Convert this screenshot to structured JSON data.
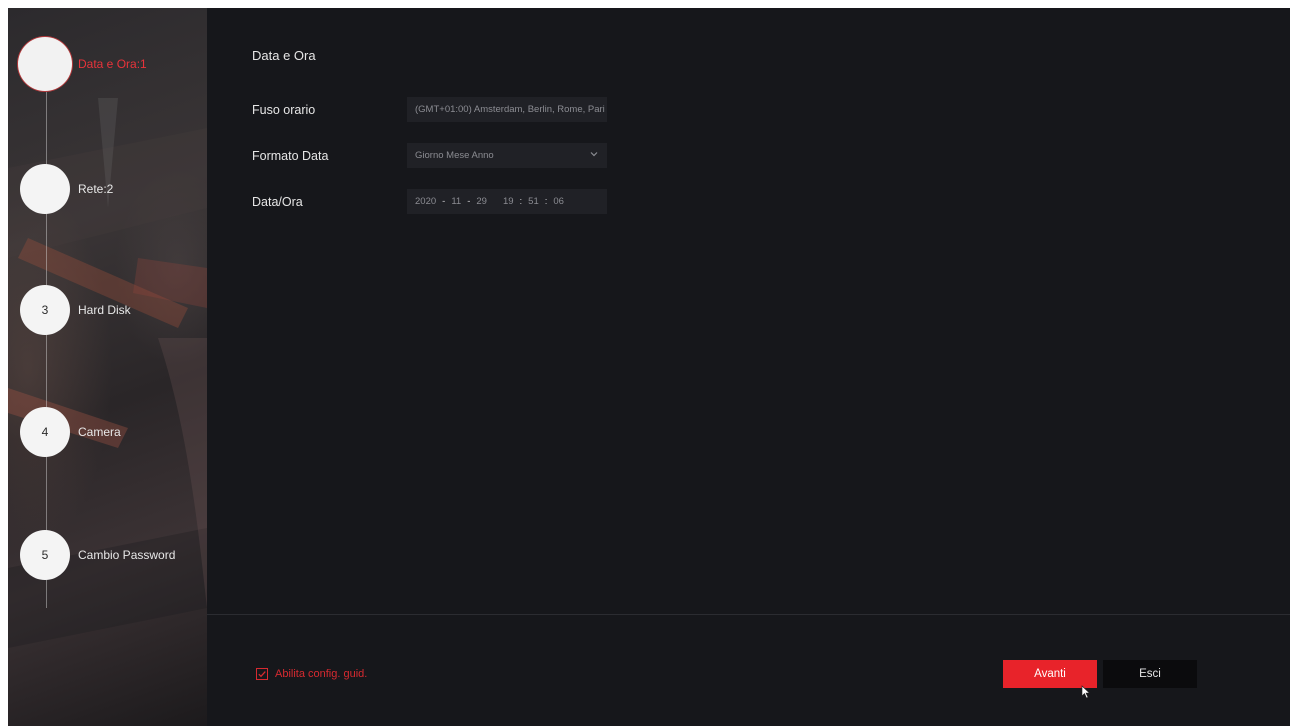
{
  "steps": [
    {
      "number": "",
      "label": "Data e Ora:1"
    },
    {
      "number": "",
      "label": "Rete:2"
    },
    {
      "number": "3",
      "label": "Hard Disk"
    },
    {
      "number": "4",
      "label": "Camera"
    },
    {
      "number": "5",
      "label": "Cambio Password"
    }
  ],
  "main": {
    "title": "Data e Ora",
    "timezone": {
      "label": "Fuso orario",
      "value": "(GMT+01:00) Amsterdam, Berlin, Rome, Pari"
    },
    "date_format": {
      "label": "Formato Data",
      "value": "Giorno Mese Anno"
    },
    "datetime": {
      "label": "Data/Ora",
      "year": "2020",
      "month": "11",
      "day": "29",
      "hour": "19",
      "minute": "51",
      "second": "06",
      "date_sep": "-",
      "time_sep": ":"
    }
  },
  "footer": {
    "checkbox_label": "Abilita config. guid.",
    "checkbox_checked": true,
    "next_label": "Avanti",
    "exit_label": "Esci"
  },
  "colors": {
    "accent": "#e8232a",
    "background": "#16171b"
  }
}
